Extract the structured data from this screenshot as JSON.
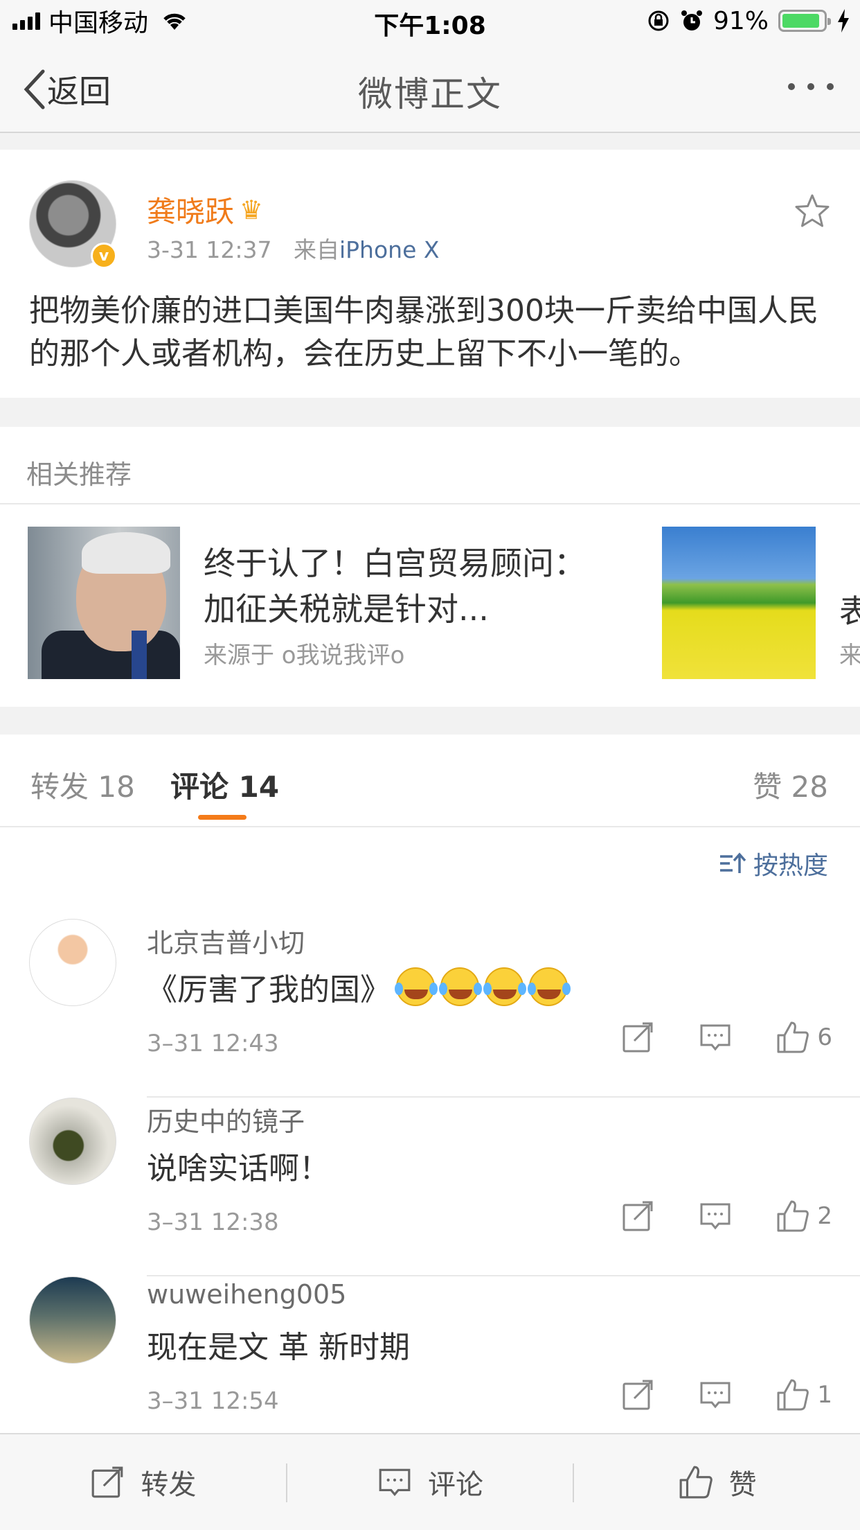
{
  "status_bar": {
    "carrier": "中国移动",
    "time": "下午1:08",
    "battery": "91%",
    "battery_level": 0.91,
    "colors": {
      "battery_fill": "#4cd964"
    }
  },
  "nav": {
    "back_label": "返回",
    "title": "微博正文"
  },
  "post": {
    "author": "龚晓跃",
    "verified_badge": "v",
    "time": "3-31 12:37",
    "source_prefix": "来自",
    "source": "iPhone X",
    "text": "把物美价廉的进口美国牛肉暴涨到300块一斤卖给中国人民的那个人或者机构，会在历史上留下不小一笔的。",
    "colors": {
      "author": "#f07b1a",
      "source": "#4d6f9c"
    }
  },
  "related": {
    "heading": "相关推荐",
    "items": [
      {
        "title": "终于认了！白宫贸易顾问：加征关税就是针对...",
        "source": "来源于 o我说我评o"
      },
      {
        "title_clip": "表",
        "source_clip": "来"
      }
    ]
  },
  "tabs": {
    "repost": "转发 18",
    "comment": "评论 14",
    "like": "赞 28",
    "colors": {
      "active_underline": "#f47b19"
    }
  },
  "comments": {
    "sort_label": "按热度",
    "items": [
      {
        "name": "北京吉普小切",
        "text": "《厉害了我的国》",
        "emoji_count": 4,
        "emoji_icon": "crying-laughing-face-icon",
        "time": "3–31 12:43",
        "likes": "6"
      },
      {
        "name": "历史中的镜子",
        "text": "说啥实话啊！",
        "time": "3–31 12:38",
        "likes": "2"
      },
      {
        "name": "wuweiheng005",
        "text": "现在是文 革 新时期",
        "time": "3–31 12:54",
        "likes": "1"
      }
    ]
  },
  "toolbar": {
    "repost": "转发",
    "comment": "评论",
    "like": "赞"
  }
}
